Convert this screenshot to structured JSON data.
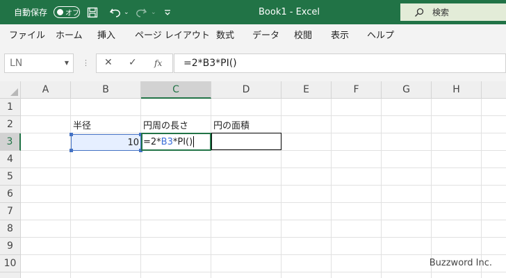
{
  "titlebar": {
    "autosave_label": "自動保存",
    "autosave_state": "オフ",
    "doc_title": "Book1  -  Excel",
    "search_label": "検索",
    "icons": [
      "save-icon",
      "undo-icon",
      "redo-icon",
      "customize-qat-icon",
      "search-icon"
    ],
    "bg_color": "#217346"
  },
  "ribbon": {
    "tabs": [
      "ファイル",
      "ホーム",
      "挿入",
      "ページ レイアウト",
      "数式",
      "データ",
      "校閲",
      "表示",
      "ヘルプ"
    ]
  },
  "formula_bar": {
    "name_box": "LN",
    "cancel_icon": "✕",
    "enter_icon": "✓",
    "fx_label": "fx",
    "formula": "=2*B3*PI()"
  },
  "grid": {
    "columns": [
      "A",
      "B",
      "C",
      "D",
      "E",
      "F",
      "G",
      "H"
    ],
    "rows": [
      "1",
      "2",
      "3",
      "4",
      "5",
      "6",
      "7",
      "8",
      "9",
      "10"
    ],
    "active_column": "C",
    "active_row": "3"
  },
  "cells": {
    "B2": "半径",
    "C2": "円周の長さ",
    "D2": "円の面積",
    "B3": "10",
    "C3_parts": [
      "=2*",
      "B3",
      "*PI()"
    ]
  },
  "watermark": "Buzzword Inc."
}
